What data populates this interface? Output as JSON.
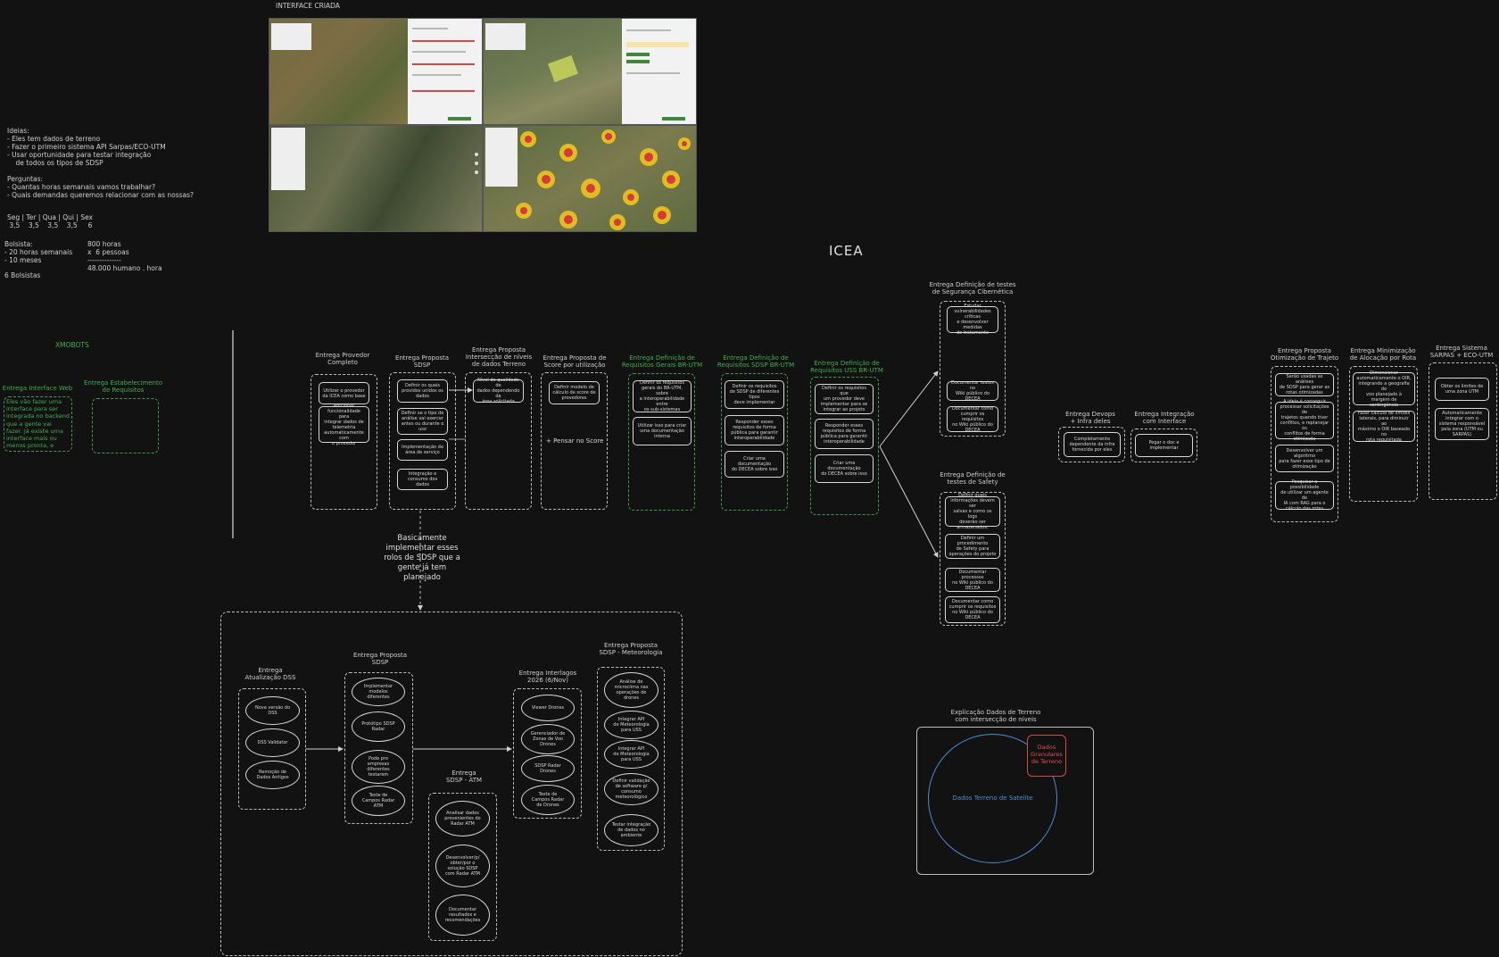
{
  "header": {
    "interface_label": "INTERFACE CRIADA",
    "main_title": "ICEA"
  },
  "notes": {
    "ideas": "Ideias:\n- Eles tem dados de terreno\n- Fazer o primeiro sistema API Sarpas/ECO-UTM\n- Usar oportunidade para testar integração\n    de todos os tipos de SDSP",
    "questions": "Perguntas:\n- Quantas horas semanais vamos trabalhar?\n- Quais demandas queremos relacionar com as nossas?",
    "weekdays": "Seg | Ter | Qua | Qui | Sex\n 3,5    3,5    3,5    3,5     6",
    "bolsista": "Bolsista:\n- 20 horas semanais\n- 10 meses",
    "hours_calc": "800 horas\nx  6 pessoas\n--------------\n48.000 humano . hora",
    "bolsistas_count": "6 Bolsistas"
  },
  "xmobots": {
    "label": "XMOBOTS",
    "web_title": "Entrega Interface Web",
    "web_text": "Eles vão fazer uma\ninterface para ser\nintegrada no backend\nque a gente vai\nfazer. Já existe uma\ninterface mais ou\nmenos pronta, e",
    "req_title": "Entrega Estabelecimento\nde Requisitos"
  },
  "top_deliveries": [
    {
      "title": "Entrega Provedor\nCompleto",
      "green": false,
      "items": [
        "Utilizar o provedor\nda ICEA como base",
        "Adicionar\nfuncionalidade para\nintegrar dados de\ntelemetria\nautomaticamente com\no provedor"
      ]
    },
    {
      "title": "Entrega Proposta\nSDSP",
      "green": false,
      "items": [
        "Definir os quais\nprovidos unidos os\ndados",
        "Definir se o tipo de\nanálise vai exercer\nantes ou durante o\nuso",
        "Implementação da\nárea de serviço",
        "Integração e\nconsumo dos dados"
      ]
    },
    {
      "title": "Entrega Proposta\nIntersecção de níveis\nde dados Terreno",
      "green": false,
      "items": [
        "Nível de qualidade de\ndados dependendo da\nárea solicitada"
      ]
    },
    {
      "title": "Entrega Proposta de\nScore por utilização",
      "green": false,
      "items": [
        "Definir modelo de\ncálculo de score de\nprovedores"
      ],
      "extra": "+ Pensar no Score"
    },
    {
      "title": "Entrega Definição de\nRequisitos Gerais BR-UTM",
      "green": true,
      "items": [
        "Definir os requisitos\ngerais do BR-UTM, sobre\na interoperabilidade entre\nos sub-sistemas",
        "Utilizar isso para criar\numa documentação\ninterna"
      ]
    },
    {
      "title": "Entrega Definição de\nRequisitos SDSP BR-UTM",
      "green": true,
      "items": [
        "Definir os requisitos\nde SDSP de diferentes tipos\ndeve implementar",
        "Responder esses\nrequisitos de forma\npública para garantir\ninteroperabilidade",
        "Criar uma documentação\ndo DECEA sobre isso"
      ]
    },
    {
      "title": "Entrega Definição de\nRequisitos USS BR-UTM",
      "green": true,
      "items": [
        "Definir os requisitos que\num provedor deve\nimplementar para se\nintegrar ao projeto",
        "Responder esses\nrequisitos de forma\npública para garantir\ninteroperabilidade",
        "Criar uma documentação\ndo DECEA sobre isso"
      ]
    }
  ],
  "security_tests": {
    "title": "Entrega Definição de testes\nde Segurança Cibernética",
    "items": [
      "Estudar\nvulnerabilidades críticas\ne desenvolver medidas\nde tratamento",
      "Documentar testes no\nWiki público do DECEA",
      "Documentar como\ncumprir os requisitos\nno Wiki público do\nDECEA"
    ]
  },
  "safety_tests": {
    "title": "Entrega Definição de\ntestes de Safety",
    "items": [
      "Definir quais\ninformações devem ser\nsalvas e como os logs\ndeverão ser\narmazenados.",
      "Definir um procedimento\nde Safety para\noperações do projeto",
      "Documentar processos\nno Wiki público do\nDECEA",
      "Documentar como\ncumprir os requisitos\nno Wiki público do\nDECEA"
    ]
  },
  "devops": {
    "title": "Entrega Devops\n+ Infra deles",
    "item": "Completamente\ndependente da infra\nfornecida por eles"
  },
  "integration": {
    "title": "Entrega Integração\ncom Interface",
    "item": "Pegar o doc e implementar"
  },
  "right_deliveries": [
    {
      "title": "Entrega Proposta\nOtimização de Trajeto",
      "items": [
        "Serão usadas as análises\nde SDSP para gerar as\nrotas otimizadas",
        "A ideia é conseguir\nprocessar solicitações de\ntrajetos quando tiver\nconflitos, e replanejar os\nconflitos de forma\notimizada",
        "Desenvolver um algoritmo\npara fazer esse tipo de\notimização",
        "Pesquisar a possibilidade\nde utilizar um agente de\nIA com RAG para o\ncálculo das rotas"
      ]
    },
    {
      "title": "Entrega Minimização\nde Alocação por Rota",
      "items": [
        "Dimensionar\nautomaticamente o OIR,\nintegrando a geografia do\nvoo planejado à margem de\ncontingência",
        "Fazer cálculo de limites\nlaterais, para diminuir ao\nmáximo o OIR baseado no\nrota requisitada"
      ]
    },
    {
      "title": "Entrega Sistema\nSARPAS + ECO-UTM",
      "items": [
        "Obter os limites de\numa zona UTM",
        "Automaticamente\nintegrar com o\nsistema responsável\npela zona (UTM ou\nSARPAS)"
      ]
    }
  ],
  "annotation": "Basicamente\nimplementar esses\nrolos de SDSP que a\ngente já tem\nplanejado",
  "bottom_group": {
    "dss": {
      "title": "Entrega\nAtualização DSS",
      "items": [
        "Nova versão do\nDSS",
        "DSS Validator",
        "Remoção de\nDados Antigos"
      ]
    },
    "sdsp": {
      "title": "Entrega Proposta\nSDSP",
      "items": [
        "Implementar\nmodelos\ndiferentes",
        "Protótipo SDSP\nRadar",
        "Pode pro\nempresas\ndiferentes\ntestarem",
        "Teste de\nCampos Radar\nATM"
      ]
    },
    "atm": {
      "title": "Entrega\nSDSP - ATM",
      "items": [
        "Analisar dados\nprovenientes do\nRadar ATM",
        "Desenvolver/p/\nobter/por o\nsolução SDSP\ncom Radar ATM",
        "Documentar\nresultados e\nrecomendações"
      ]
    },
    "interlagos": {
      "title": "Entrega Interlagos\n2026 (6/Nov)",
      "items": [
        "Viewer Drones",
        "Gerenciador de\nZonas de Voo\nDrones",
        "SDSP Radar\nDrones",
        "Teste de\nCampos Radar\nde Drones"
      ]
    },
    "meteo": {
      "title": "Entrega Proposta\nSDSP - Meteorologia",
      "items": [
        "Análise de\nmicroclima nas\noperações de\ndrones",
        "Integrar API\nde Meteorologia\npara USS",
        "Integrar API\nde Meteorologia\npara USS",
        "Definir validação\nde software p/\nconsumo\nmeteorológico",
        "Testar integração\nde dados no\nambiente"
      ]
    }
  },
  "terrain": {
    "title": "Explicação Dados de Terreno\ncom intersecção de níveis",
    "satellite": "Dados Terreno de Satelite",
    "granular": "Dados\nGranulares\nde Terreno"
  }
}
